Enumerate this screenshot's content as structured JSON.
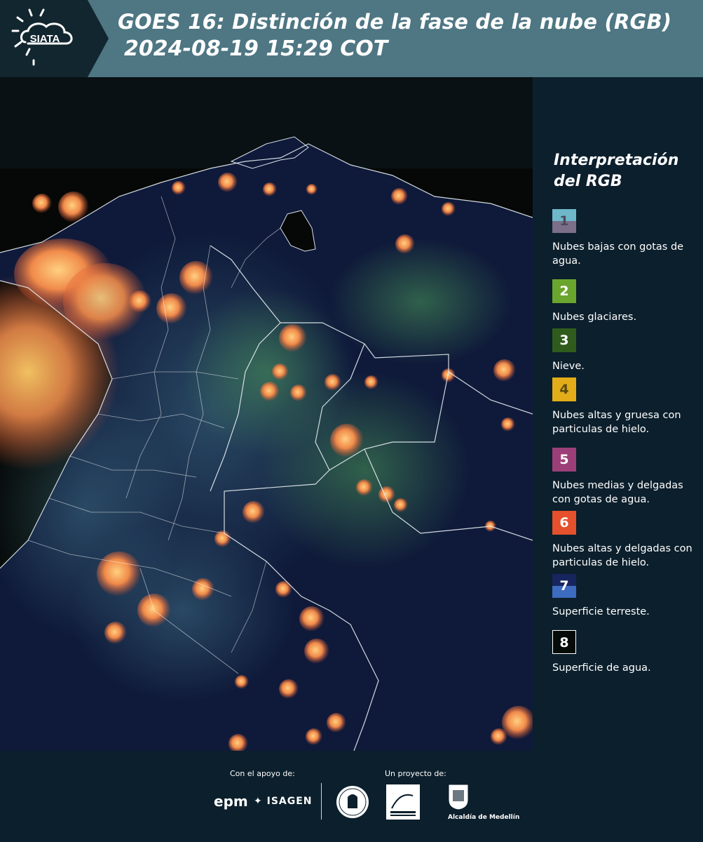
{
  "header": {
    "logo_text": "SIATA",
    "title_line1": "GOES 16: Distinción de la fase de la nube (RGB)",
    "title_line2": "2024-08-19 15:29 COT"
  },
  "legend": {
    "title_line1": "Interpretación",
    "title_line2": "del RGB",
    "items": [
      {
        "num": "1",
        "label": "Nubes bajas con gotas de agua.",
        "color_top": "#6fb8c9",
        "color_bottom": "#7b6f8a",
        "text_color": "#4b4b5a"
      },
      {
        "num": "2",
        "label": "Nubes glaciares.",
        "color_top": "#6aa52e",
        "color_bottom": "#6aa52e",
        "text_color": "#ffffff"
      },
      {
        "num": "3",
        "label": "Nieve.",
        "color_top": "#2f5c1c",
        "color_bottom": "#2f5c1c",
        "text_color": "#ffffff"
      },
      {
        "num": "4",
        "label": "Nubes altas y gruesa con particulas de hielo.",
        "color_top": "#e2ad18",
        "color_bottom": "#e2ad18",
        "text_color": "#5a4a10"
      },
      {
        "num": "5",
        "label": "Nubes medias y delgadas con gotas de agua.",
        "color_top": "#9c3f78",
        "color_bottom": "#9c3f78",
        "text_color": "#ffffff"
      },
      {
        "num": "6",
        "label": "Nubes altas y delgadas con particulas de hielo.",
        "color_top": "#e4512c",
        "color_bottom": "#e4512c",
        "text_color": "#ffffff"
      },
      {
        "num": "7",
        "label": "Superficie terreste.",
        "color_top": "#17255e",
        "color_bottom": "#3d6bbf",
        "text_color": "#ffffff"
      },
      {
        "num": "8",
        "label": "Superficie de agua.",
        "color_top": "#050b08",
        "color_bottom": "#050b08",
        "text_color": "#ffffff"
      }
    ]
  },
  "footer": {
    "support_label": "Con el apoyo de:",
    "project_label": "Un proyecto de:",
    "epm": "epm",
    "isagen": "ISAGEN",
    "alcaldia": "Alcaldía de Medellín"
  },
  "colors": {
    "header_bg": "#4e7683",
    "page_bg": "#0c1f2c",
    "land": "#0f1a3a",
    "ocean": "#050807"
  }
}
